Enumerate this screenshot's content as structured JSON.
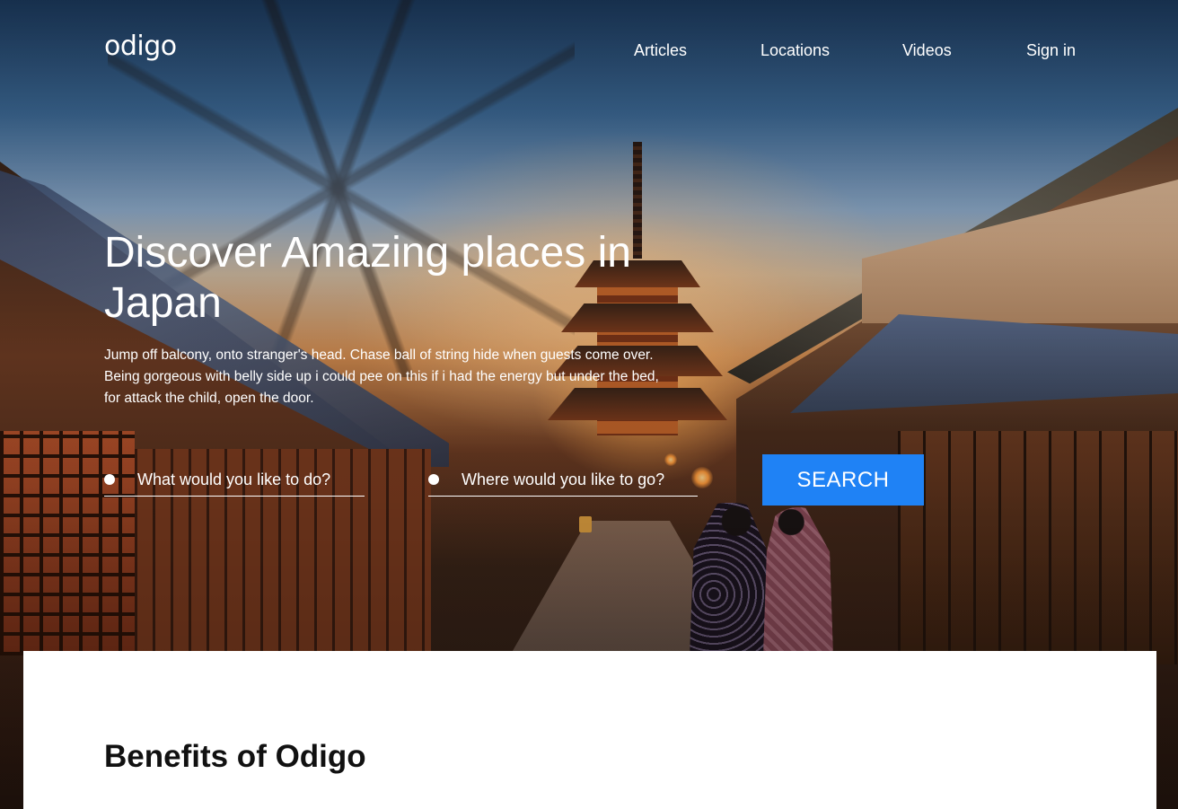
{
  "header": {
    "logo": "odigo",
    "nav": {
      "articles": "Articles",
      "locations": "Locations",
      "videos": "Videos",
      "sign_in": "Sign in"
    }
  },
  "hero": {
    "title": "Discover Amazing places in Japan",
    "description": "Jump off balcony, onto stranger's head. Chase ball of string hide when guests come over. Being gorgeous with belly side up i could pee on this if i had the energy but under the bed, for attack the child, open the door.",
    "search": {
      "activity_placeholder": "What would you like to do?",
      "destination_placeholder": "Where would you like to go?",
      "button_label": "SEARCH"
    }
  },
  "content": {
    "benefits_title": "Benefits of Odigo"
  },
  "colors": {
    "accent": "#1f82f5",
    "text_on_hero": "#ffffff",
    "heading_dark": "#111111"
  }
}
